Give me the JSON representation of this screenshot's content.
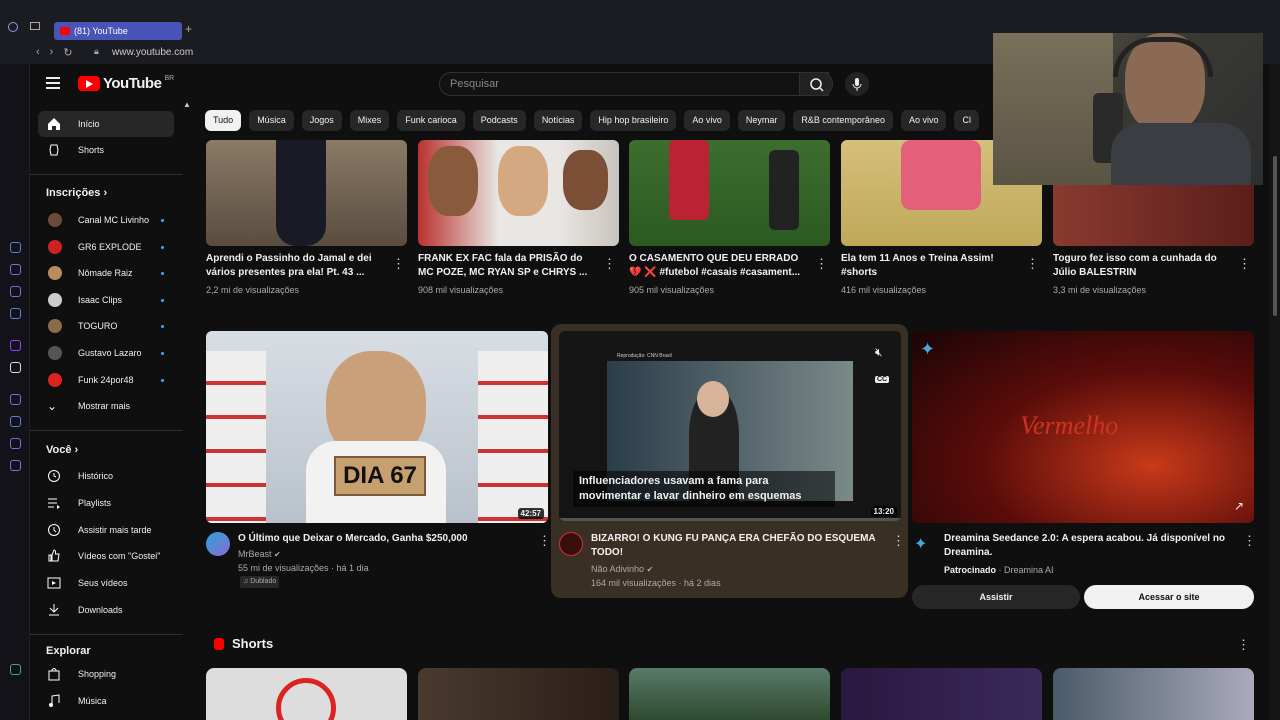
{
  "browser": {
    "tab_title": "(81) YouTube",
    "url": "www.youtube.com"
  },
  "header": {
    "logo_text": "YouTube",
    "country": "BR",
    "search_placeholder": "Pesquisar"
  },
  "sidebar": {
    "main": [
      {
        "label": "Início",
        "icon": "home-icon",
        "active": true
      },
      {
        "label": "Shorts",
        "icon": "shorts-icon"
      }
    ],
    "subscriptions_title": "Inscrições",
    "subscriptions": [
      {
        "label": "Canal MC Livinho"
      },
      {
        "label": "GR6 EXPLODE"
      },
      {
        "label": "Nômade Raiz"
      },
      {
        "label": "Isaac Clips"
      },
      {
        "label": "TOGURO"
      },
      {
        "label": "Gustavo Lazaro"
      },
      {
        "label": "Funk 24por48"
      }
    ],
    "show_more": "Mostrar mais",
    "you_title": "Você",
    "you_items": [
      {
        "label": "Histórico",
        "icon": "history-icon"
      },
      {
        "label": "Playlists",
        "icon": "playlists-icon"
      },
      {
        "label": "Assistir mais tarde",
        "icon": "watch-later-icon"
      },
      {
        "label": "Vídeos com \"Gostei\"",
        "icon": "like-icon"
      },
      {
        "label": "Seus vídeos",
        "icon": "your-videos-icon"
      },
      {
        "label": "Downloads",
        "icon": "download-icon"
      }
    ],
    "explore_title": "Explorar",
    "explore_items": [
      {
        "label": "Shopping",
        "icon": "shopping-icon"
      },
      {
        "label": "Música",
        "icon": "music-icon"
      }
    ]
  },
  "chips": [
    "Tudo",
    "Música",
    "Jogos",
    "Mixes",
    "Funk carioca",
    "Podcasts",
    "Notícias",
    "Hip hop brasileiro",
    "Ao vivo",
    "Neymar",
    "R&B contemporâneo",
    "Ao vivo",
    "Cl"
  ],
  "row1": [
    {
      "title1": "Aprendi o Passinho do Jamal e dei",
      "title2": "vários presentes pra ela! Pt. 43 ...",
      "meta": "2,2 mi de visualizações",
      "color": "#6b5a48"
    },
    {
      "title1": "FRANK EX FAC fala da PRISÃO do",
      "title2": "MC POZE, MC RYAN SP e CHRYS ...",
      "meta": "908 mil visualizações",
      "color": "#b8322f"
    },
    {
      "title1": "O CASAMENTO QUE DEU ERRADO",
      "title2": "💔 ❌ #futebol #casais #casament...",
      "meta": "905 mil visualizações",
      "color": "#3c6e2e"
    },
    {
      "title1": "Ela tem 11 Anos e Treina Assim!",
      "title2": "#shorts",
      "meta": "416 mil visualizações",
      "color": "#c9b04a"
    },
    {
      "title1": "Toguro fez isso com a cunhada do",
      "title2": "Júlio BALESTRIN",
      "meta": "3,3 mi de visualizações",
      "color": "#7a2e26"
    }
  ],
  "row2": [
    {
      "title": "O Último que Deixar o Mercado, Ganha $250,000",
      "channel": "MrBeast",
      "meta": "55 mi de visualizações · há 1 dia",
      "badge": "Dublado",
      "duration": "42:57",
      "thumb_text": "DIA 67"
    },
    {
      "title1": "BIZARRO! O KUNG FU PANÇA ERA CHEFÃO DO ESQUEMA",
      "title2": "TODO!",
      "channel": "Não Adivinho",
      "meta": "164 mil visualizações · há 2 dias",
      "duration": "13:20",
      "overlay1": "Influenciadores usavam a fama para",
      "overlay2": "movimentar e lavar dinheiro em esquemas",
      "source": "Reprodução: CNN Brasil",
      "cc": "CC"
    },
    {
      "title1": "Dreamina Seedance 2.0: A espera acabou. Já disponível no",
      "title2": "Dreamina.",
      "sponsored": "Patrocinado",
      "advertiser": "Dreamina AI",
      "thumb_text": "Vermelho",
      "btn_watch": "Assistir",
      "btn_site": "Acessar o site"
    }
  ],
  "shorts_title": "Shorts"
}
